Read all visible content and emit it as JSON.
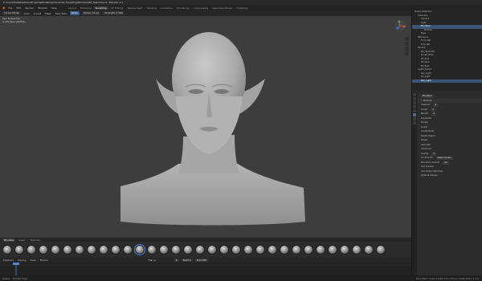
{
  "window": {
    "title": "C:\\Users\\Fiat\\Desktop\\3D GameModeling\\Character Sculpting\\Elf Head\\Elf_Head.blend - Blender 4.1"
  },
  "menu": {
    "items": [
      "File",
      "Edit",
      "Render",
      "Window",
      "Help"
    ]
  },
  "workspaces": {
    "tabs": [
      "Layout",
      "Modeling",
      "Sculpting",
      "UV Editing",
      "Texture Paint",
      "Shading",
      "Animation",
      "Rendering",
      "Compositing",
      "Geometry Nodes",
      "Scripting"
    ],
    "active_index": 2
  },
  "viewport_header": {
    "mode": "Sculpt Mode",
    "menus": [
      "View",
      "Sculpt",
      "Mask",
      "Face Sets"
    ],
    "brush": "Draw",
    "radius": "Radius 50 px",
    "strength": "Strength 0.500"
  },
  "viewport": {
    "overlay_line1": "User Perspective",
    "overlay_line2": "(1) Elf_Head | Multires"
  },
  "bottom_tabs": [
    "Brushes",
    "Asset",
    "Textures"
  ],
  "brushes": {
    "count": 32,
    "active_index": 11
  },
  "timeline": {
    "menus": [
      "Playback",
      "Keying",
      "View",
      "Marker"
    ],
    "frame": "1",
    "start": "Start 1",
    "end": "End 250"
  },
  "outliner": {
    "items": [
      {
        "label": "Scene Collection",
        "indent": 0,
        "sel": false
      },
      {
        "label": "Collection",
        "indent": 1,
        "sel": false
      },
      {
        "label": "Camera",
        "indent": 2,
        "sel": false
      },
      {
        "label": "Light",
        "indent": 2,
        "sel": false
      },
      {
        "label": "Elf_Head",
        "indent": 2,
        "sel": true
      },
      {
        "label": "Multires",
        "indent": 3,
        "sel": false
      },
      {
        "label": "Eyes",
        "indent": 2,
        "sel": false
      },
      {
        "label": "Reference",
        "indent": 1,
        "sel": false
      },
      {
        "label": "Front_Ref",
        "indent": 2,
        "sel": false
      },
      {
        "label": "Side_Ref",
        "indent": 2,
        "sel": false
      },
      {
        "label": "Backup",
        "indent": 1,
        "sel": false
      },
      {
        "label": "Elf_Head.001",
        "indent": 2,
        "sel": false
      },
      {
        "label": "Sculpt_Base",
        "indent": 2,
        "sel": false
      },
      {
        "label": "Elf_Ears",
        "indent": 2,
        "sel": false
      },
      {
        "label": "Elf_Neck",
        "indent": 2,
        "sel": false
      },
      {
        "label": "Elf_Bust",
        "indent": 2,
        "sel": false
      },
      {
        "label": "Lights_Studio",
        "indent": 1,
        "sel": false
      },
      {
        "label": "Key_Light",
        "indent": 2,
        "sel": false
      },
      {
        "label": "Fill_Light",
        "indent": 2,
        "sel": false
      },
      {
        "label": "Rim_Light",
        "indent": 2,
        "sel": true
      }
    ]
  },
  "properties": {
    "object": "Elf_Head",
    "modifier": "Multires",
    "rows": [
      {
        "label": "Viewport",
        "value": "4"
      },
      {
        "label": "Sculpt",
        "value": "4"
      },
      {
        "label": "Render",
        "value": "4"
      },
      {
        "label": "Subdivide",
        "value": ""
      },
      {
        "label": "Simple",
        "value": ""
      },
      {
        "label": "Linear",
        "value": ""
      },
      {
        "label": "Unsubdivide",
        "value": ""
      },
      {
        "label": "Delete Higher",
        "value": ""
      },
      {
        "label": "Shape",
        "value": ""
      },
      {
        "label": "Generate",
        "value": ""
      },
      {
        "label": "Advanced",
        "value": ""
      },
      {
        "label": "Quality",
        "value": "4"
      },
      {
        "label": "UV Smooth",
        "value": "Keep Corners"
      },
      {
        "label": "Boundary Smooth",
        "value": "All"
      },
      {
        "label": "Use Creases",
        "value": ""
      },
      {
        "label": "Use Custom Normals",
        "value": ""
      },
      {
        "label": "Optimal Display",
        "value": ""
      }
    ]
  },
  "status": {
    "left": "Select",
    "mid": "Rotate View",
    "right": "Elf_Head | Verts 1,048,576 | Faces 1,048,576 | 4.1.0"
  }
}
